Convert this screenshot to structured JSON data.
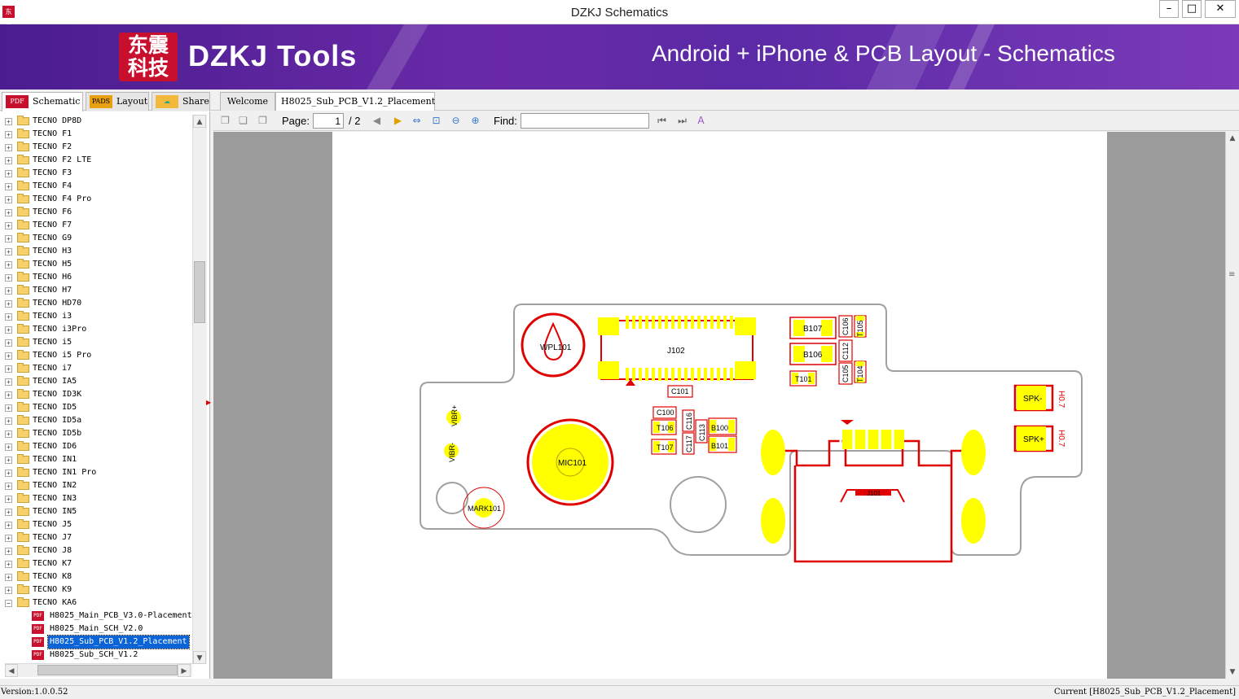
{
  "window": {
    "title": "DZKJ Schematics",
    "minimize": "–",
    "maximize": "□",
    "close": "✕",
    "app_icon": "东震"
  },
  "banner": {
    "logo_text": "东震科技",
    "brand": "DZKJ Tools",
    "tagline": "Android + iPhone & PCB Layout - Schematics"
  },
  "main_tabs": [
    {
      "label": "Schematic",
      "icon": "PDF",
      "active": true
    },
    {
      "label": "Layout",
      "icon": "PADS",
      "active": false
    },
    {
      "label": "Share",
      "icon": "share-icon",
      "active": false
    }
  ],
  "doc_tabs": [
    {
      "label": "Welcome",
      "active": false
    },
    {
      "label": "H8025_Sub_PCB_V1.2_Placement",
      "active": true
    }
  ],
  "tree": {
    "folders": [
      "TECNO DP8D",
      "TECNO F1",
      "TECNO F2",
      "TECNO F2 LTE",
      "TECNO F3",
      "TECNO F4",
      "TECNO F4 Pro",
      "TECNO F6",
      "TECNO F7",
      "TECNO G9",
      "TECNO H3",
      "TECNO H5",
      "TECNO H6",
      "TECNO H7",
      "TECNO HD70",
      "TECNO i3",
      "TECNO i3Pro",
      "TECNO i5",
      "TECNO i5 Pro",
      "TECNO i7",
      "TECNO IA5",
      "TECNO ID3K",
      "TECNO ID5",
      "TECNO ID5a",
      "TECNO ID5b",
      "TECNO ID6",
      "TECNO IN1",
      "TECNO IN1 Pro",
      "TECNO IN2",
      "TECNO IN3",
      "TECNO IN5",
      "TECNO J5",
      "TECNO J7",
      "TECNO J8",
      "TECNO K7",
      "TECNO K8",
      "TECNO K9",
      "TECNO KA6"
    ],
    "files": [
      "H8025_Main_PCB_V3.0-Placement",
      "H8025_Main_SCH_V2.0",
      "H8025_Sub_PCB_V1.2_Placement",
      "H8025_Sub_SCH_V1.2"
    ],
    "selected_file": "H8025_Sub_PCB_V1.2_Placement"
  },
  "viewer_toolbar": {
    "page_label": "Page:",
    "page_current": "1",
    "page_total": "/ 2",
    "find_label": "Find:",
    "find_value": ""
  },
  "pcb": {
    "components": [
      "WPL101",
      "J102",
      "B107",
      "B106",
      "C106",
      "C112",
      "T105",
      "T104",
      "C105",
      "T101",
      "C101",
      "C100",
      "T106",
      "T107",
      "C116",
      "C117",
      "C113",
      "B100",
      "B101",
      "VIBR+",
      "VIBR-",
      "MIC101",
      "MARK101",
      "SPK-",
      "SPK+",
      "H0.7",
      "J101"
    ]
  },
  "status": {
    "version": "Version:1.0.0.52",
    "current": "Current [H8025_Sub_PCB_V1.2_Placement]"
  },
  "colors": {
    "banner": "#5b2aa6",
    "pad": "#ffff00",
    "outline": "#e00000",
    "board": "#a0a0a0",
    "selection": "#0a64d8"
  }
}
